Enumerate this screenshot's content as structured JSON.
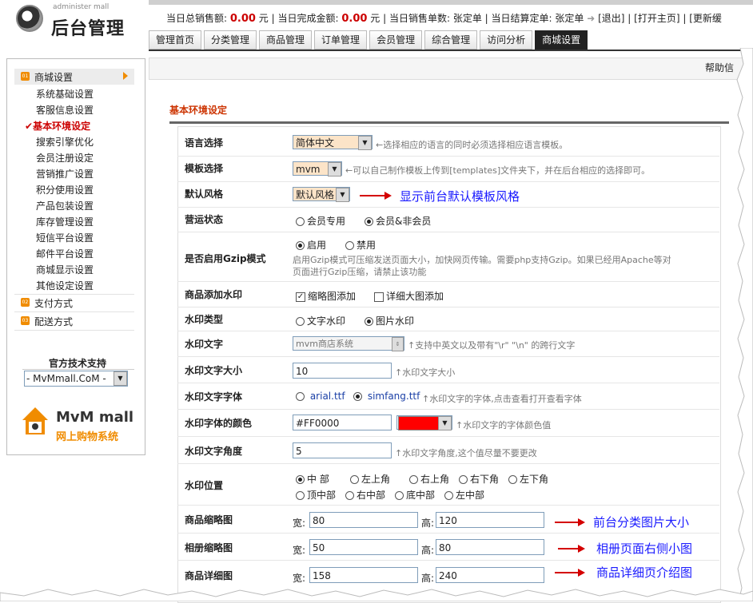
{
  "header": {
    "logo_small": "administer mall",
    "logo_title": "后台管理",
    "stats": {
      "total_label": "当日总销售额:",
      "total_value": "0.00",
      "total_unit": "元",
      "done_label": "当日完成金额:",
      "done_value": "0.00",
      "done_unit": "元",
      "sold_count_label": "当日销售单数:",
      "sold_count_value": "张定单",
      "settle_label": "当日结算定单:",
      "settle_value": "张定单",
      "logout": "[退出]",
      "open_home": "[打开主页]",
      "update": "[更新缓"
    },
    "tabs": [
      "管理首页",
      "分类管理",
      "商品管理",
      "订单管理",
      "会员管理",
      "综合管理",
      "访问分析",
      "商城设置"
    ],
    "active_tab": "商城设置"
  },
  "sidebar": {
    "group1": {
      "num": "01",
      "label": "商城设置"
    },
    "items": [
      "系统基础设置",
      "客服信息设置",
      "基本环境设定",
      "搜索引擎优化",
      "会员注册设定",
      "营销推广设置",
      "积分使用设置",
      "产品包装设置",
      "库存管理设置",
      "短信平台设置",
      "邮件平台设置",
      "商城显示设置",
      "其他设定设置"
    ],
    "active_item": "基本环境设定",
    "group2": {
      "num": "02",
      "label": "支付方式"
    },
    "group3": {
      "num": "03",
      "label": "配送方式"
    },
    "support_title": "官方技术支持",
    "support_select": "- MvMmall.CoM -",
    "brand_name": "MvM mall",
    "brand_sub": "网上购物系统"
  },
  "main": {
    "help": "帮助信",
    "section_title": "基本环境设定",
    "rows": {
      "language": {
        "label": "语言选择",
        "value": "简体中文",
        "hint": "←选择相应的语言的同时必须选择相应语言模板。"
      },
      "template": {
        "label": "模板选择",
        "value": "mvm",
        "hint": "←可以自己制作模板上传到[templates]文件夹下，并在后台相应的选择即可。"
      },
      "style": {
        "label": "默认风格",
        "value": "默认风格",
        "annotation": "显示前台默认模板风格"
      },
      "status": {
        "label": "营运状态",
        "opt1": "会员专用",
        "opt2": "会员&非会员"
      },
      "gzip": {
        "label": "是否启用Gzip模式",
        "opt1": "启用",
        "opt2": "禁用",
        "hint1": "启用Gzip模式可压缩发送页面大小，加快网页传输。需要php支持Gzip。如果已经用Apache等对",
        "hint2": "页面进行Gzip压缩，请禁止该功能"
      },
      "watermark": {
        "label": "商品添加水印",
        "opt1": "缩略图添加",
        "opt2": "详细大图添加"
      },
      "wm_type": {
        "label": "水印类型",
        "opt1": "文字水印",
        "opt2": "图片水印"
      },
      "wm_text": {
        "label": "水印文字",
        "value": "mvm商店系统",
        "hint": "↑支持中英文以及带有\"\\r\" \"\\n\" 的跨行文字"
      },
      "wm_size": {
        "label": "水印文字大小",
        "value": "10",
        "hint": "↑水印文字大小"
      },
      "wm_font": {
        "label": "水印文字字体",
        "opt1": "arial.ttf",
        "opt2": "simfang.ttf",
        "hint": "↑水印文字的字体,点击查看打开查看字体"
      },
      "wm_color": {
        "label": "水印字体的颜色",
        "value": "#FF0000",
        "hint": "↑水印文字的字体颜色值"
      },
      "wm_angle": {
        "label": "水印文字角度",
        "value": "5",
        "hint": "↑水印文字角度,这个值尽量不要更改"
      },
      "wm_pos": {
        "label": "水印位置",
        "opts": [
          "中 部",
          "左上角",
          "右上角",
          "右下角",
          "左下角",
          "顶中部",
          "右中部",
          "底中部",
          "左中部"
        ]
      },
      "thumb": {
        "label": "商品缩略图",
        "w_label": "宽:",
        "w": "80",
        "h_label": "高:",
        "h": "120",
        "annotation": "前台分类图片大小"
      },
      "album": {
        "label": "相册缩略图",
        "w_label": "宽:",
        "w": "50",
        "h_label": "高:",
        "h": "80",
        "annotation": "相册页面右侧小图"
      },
      "detail": {
        "label": "商品详细图",
        "w_label": "宽:",
        "w": "158",
        "h_label": "高:",
        "h": "240",
        "annotation": "商品详细页介绍图"
      }
    }
  },
  "colors": {
    "accent_red": "#cc0000",
    "orange": "#f08c00",
    "annotation_blue": "#1a1aff",
    "arrow_red": "#d40000",
    "watermark_color": "#FF0000"
  }
}
